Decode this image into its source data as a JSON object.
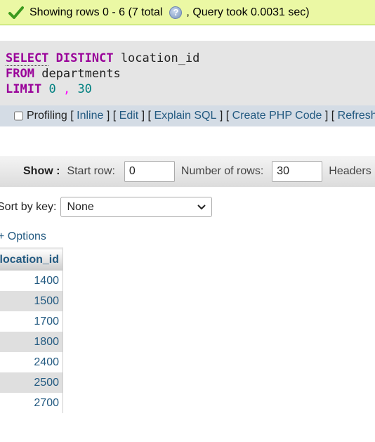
{
  "status": {
    "text_before": "Showing rows 0 - 6 (7 total",
    "text_after": ", Query took 0.0031 sec)"
  },
  "sql": {
    "line1_keyword1": "SELECT",
    "line1_keyword2": "DISTINCT",
    "line1_ident": "location_id",
    "line2_keyword": "FROM",
    "line2_ident": "departments",
    "line3_keyword": "LIMIT",
    "line3_num1": "0",
    "line3_comma": ",",
    "line3_num2": "30"
  },
  "profiling": {
    "label": "Profiling",
    "links": [
      "Inline",
      "Edit",
      "Explain SQL",
      "Create PHP Code",
      "Refresh"
    ]
  },
  "navigation": {
    "show_label": "Show :",
    "start_row_label": "Start row:",
    "start_row_value": "0",
    "num_rows_label": "Number of rows:",
    "num_rows_value": "30",
    "headers_label": "Headers"
  },
  "sort": {
    "label": "Sort by key:",
    "selected": "None"
  },
  "options_link": "+ Options",
  "table": {
    "column": "location_id",
    "rows": [
      "1400",
      "1500",
      "1700",
      "1800",
      "2400",
      "2500",
      "2700"
    ]
  },
  "colors": {
    "success_bg": "#ebf8a4",
    "keyword": "#990099",
    "number": "#008080",
    "link": "#235a81"
  }
}
